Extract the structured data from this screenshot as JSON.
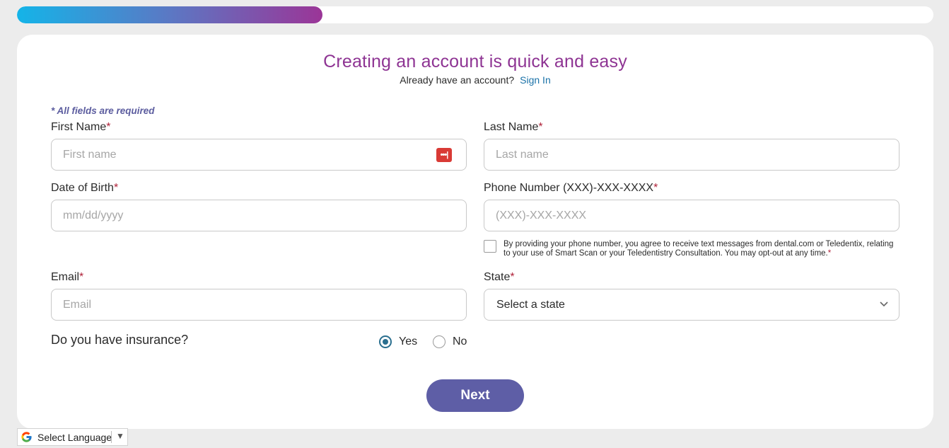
{
  "progress": {
    "fraction": 0.333
  },
  "header": {
    "title": "Creating an account is quick and easy",
    "already_text": "Already have an account?",
    "signin_label": "Sign In"
  },
  "form": {
    "required_note": "* All fields are required",
    "first_name": {
      "label": "First Name",
      "placeholder": "First name",
      "value": ""
    },
    "last_name": {
      "label": "Last Name",
      "placeholder": "Last name",
      "value": ""
    },
    "dob": {
      "label": "Date of Birth",
      "placeholder": "mm/dd/yyyy",
      "value": ""
    },
    "phone": {
      "label": "Phone Number (XXX)-XXX-XXXX",
      "placeholder": "(XXX)-XXX-XXXX",
      "value": ""
    },
    "consent_text": "By providing your phone number, you agree to receive text messages from dental.com or Teledentix, relating to your use of Smart Scan or your Teledentistry Consultation. You may opt-out at any time.",
    "consent_checked": false,
    "email": {
      "label": "Email",
      "placeholder": "Email",
      "value": ""
    },
    "state": {
      "label": "State",
      "selected": "Select a state"
    },
    "insurance": {
      "question": "Do you have insurance?",
      "yes_label": "Yes",
      "no_label": "No",
      "selected": "Yes"
    },
    "required_mark": "*",
    "next_label": "Next"
  },
  "translate": {
    "label": "Select Language",
    "arrow": "▼"
  },
  "colors": {
    "title": "#8e3493",
    "link": "#1a72a8",
    "button": "#5e5ea6",
    "required": "#b0233a",
    "radio": "#2a6f8f"
  },
  "icons": {
    "password_manager": "password-manager-icon",
    "google": "google-g-icon",
    "select_chevron": "chevron-down-icon"
  }
}
